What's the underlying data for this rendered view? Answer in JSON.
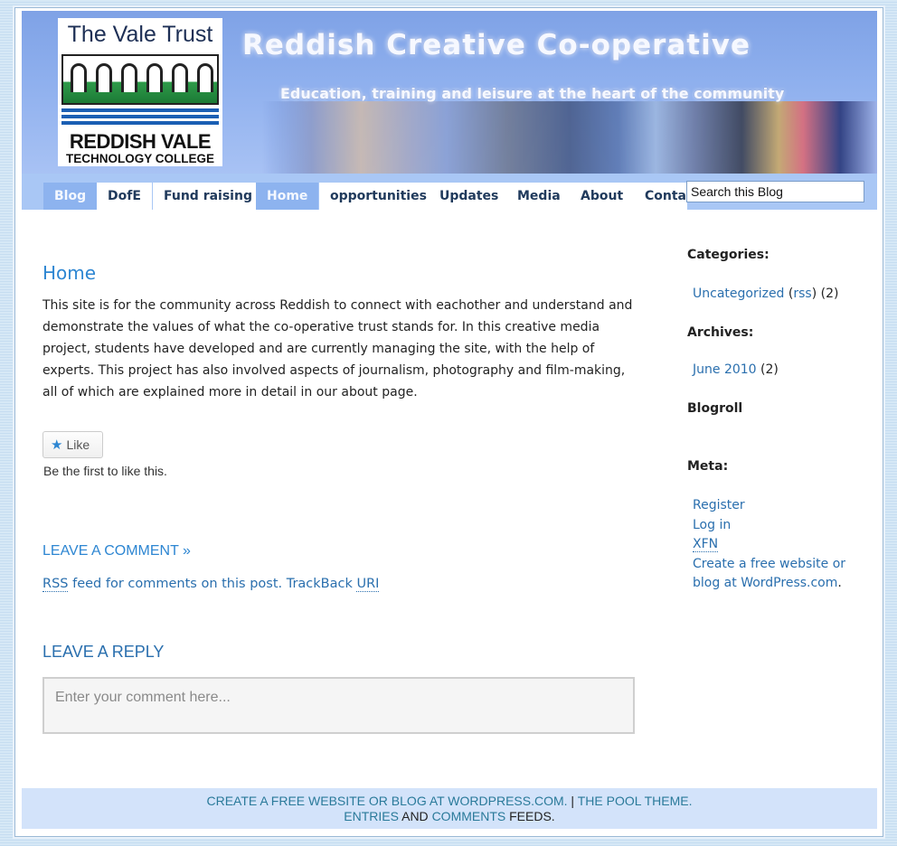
{
  "header": {
    "logo_title": "The Vale Trust",
    "logo_name": "REDDISH VALE",
    "logo_sub": "TECHNOLOGY COLLEGE",
    "site_title": "Reddish Creative Co-operative",
    "tagline": "Education, training and leisure at the heart of the community"
  },
  "nav": {
    "tabs": [
      "Blog",
      "DofE",
      "Fund raising",
      "Home",
      "opportunities",
      "Updates",
      "Media",
      "About",
      "Contact"
    ],
    "active": [
      "Blog",
      "Home"
    ]
  },
  "search": {
    "value": "Search this Blog"
  },
  "post": {
    "title": "Home",
    "body": "This site is for the community across Reddish to connect with eachother and understand and demonstrate the values of what the co-operative trust stands for. In this creative media project, students have developed and are currently managing the site, with the help of experts. This project has also involved aspects of journalism, photography and film-making, all of which are explained more in detail in our about page."
  },
  "like": {
    "button": "Like",
    "text": "Be the first to like this."
  },
  "comments": {
    "leave_comment": "Leave a comment »",
    "rss_abbr": "RSS",
    "rss_text": " feed for comments on this post. TrackBack ",
    "uri_abbr": "URI",
    "reply_title": "Leave a Reply",
    "placeholder": "Enter your comment here..."
  },
  "sidebar": {
    "categories_head": "Categories:",
    "category": "Uncategorized",
    "category_rss": "rss",
    "category_count": "(2)",
    "archives_head": "Archives:",
    "archive": "June 2010",
    "archive_count": "(2)",
    "blogroll_head": "Blogroll",
    "meta_head": "Meta:",
    "meta_register": "Register",
    "meta_login": "Log in",
    "meta_xfn": "XFN",
    "meta_wp_1": "Create a free website or",
    "meta_wp_2": "blog at WordPress.com"
  },
  "footer": {
    "wp_link": "Create a free website or blog at WordPress.com.",
    "sep": " | ",
    "theme_link": "The Pool Theme.",
    "entries": "Entries",
    "and": " and ",
    "comments": "Comments",
    "feeds": " feeds."
  },
  "colors": {
    "accent": "#2d86d2",
    "nav_active": "#8db3ef",
    "header_blue": "#8fb0ee"
  }
}
